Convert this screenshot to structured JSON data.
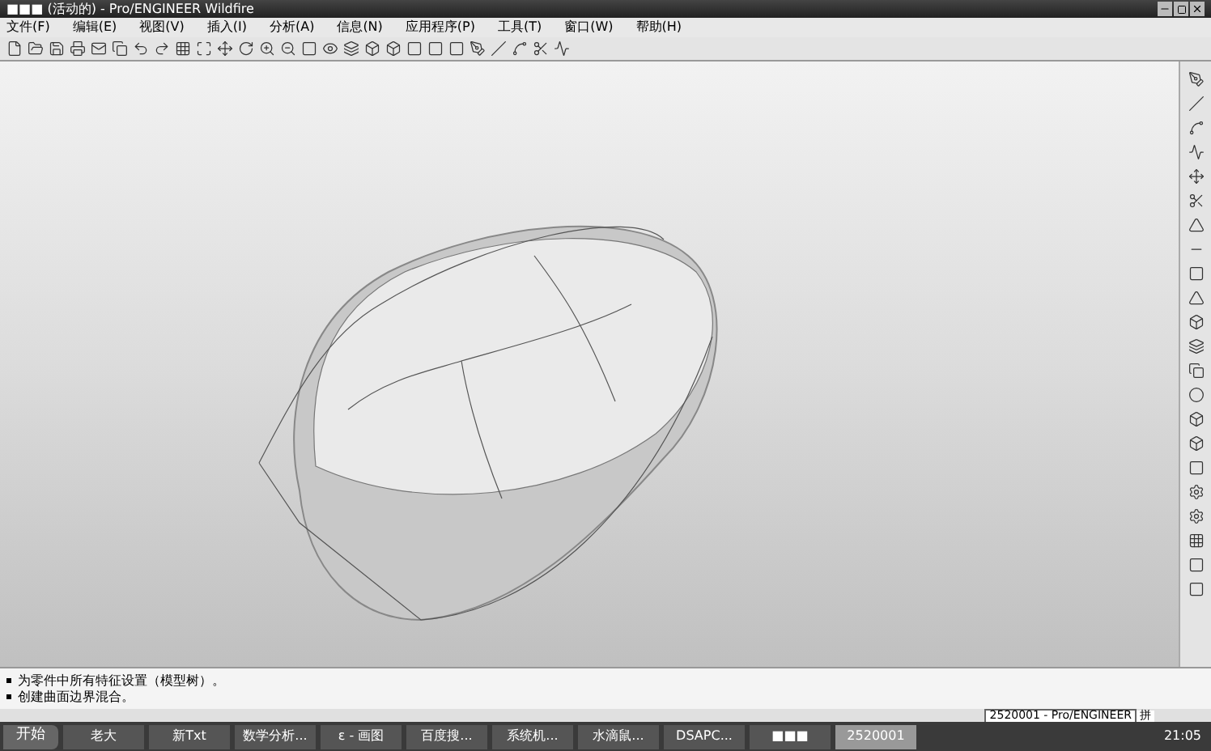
{
  "window": {
    "title": "■■■ (活动的) - Pro/ENGINEER Wildfire"
  },
  "menu": [
    "文件(F)",
    "编辑(E)",
    "视图(V)",
    "插入(I)",
    "分析(A)",
    "信息(N)",
    "应用程序(P)",
    "工具(T)",
    "窗口(W)",
    "帮助(H)"
  ],
  "messages": [
    "为零件中所有特征设置（模型树）。",
    "创建曲面边界混合。"
  ],
  "status_field": {
    "value": "2520001 - Pro/ENGINEER",
    "ime": "拼"
  },
  "taskbar": {
    "start": "开始",
    "items": [
      {
        "label": "老大",
        "selected": false
      },
      {
        "label": "新Txt",
        "selected": false
      },
      {
        "label": "数学分析...",
        "selected": false
      },
      {
        "label": "ε - 画图",
        "selected": false
      },
      {
        "label": "百度搜...",
        "selected": false
      },
      {
        "label": "系统机...",
        "selected": false
      },
      {
        "label": "水滴鼠...",
        "selected": false
      },
      {
        "label": "DSAPC...",
        "selected": false
      },
      {
        "label": "■■■",
        "selected": false
      },
      {
        "label": "2520001",
        "selected": true
      }
    ],
    "clock": "21:05"
  }
}
